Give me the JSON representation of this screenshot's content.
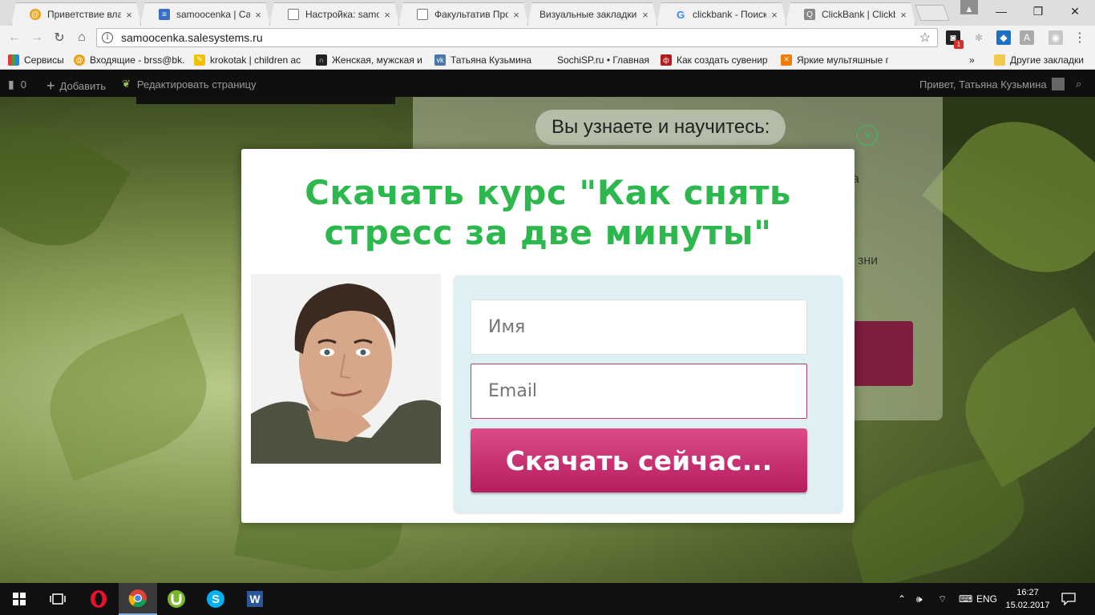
{
  "browser": {
    "tabs": [
      {
        "title": "Приветствие влад",
        "icon": "at-icon",
        "active": false
      },
      {
        "title": "samoocenka | Сайт",
        "icon": "page-blue-icon",
        "active": true
      },
      {
        "title": "Настройка: samoo",
        "icon": "doc-icon",
        "active": false
      },
      {
        "title": "Факультатив Прод",
        "icon": "doc-icon",
        "active": false
      },
      {
        "title": "Визуальные закладки",
        "icon": "bookmarks-icon",
        "active": false
      },
      {
        "title": "clickbank - Поиск",
        "icon": "google-icon",
        "active": false
      },
      {
        "title": "ClickBank | Clickba",
        "icon": "search-page-icon",
        "active": false
      }
    ],
    "url": "samoocenka.salesystems.ru",
    "extension_badge": "1",
    "bookmarks": [
      {
        "label": "Сервисы",
        "icon": "apps-icon"
      },
      {
        "label": "Входящие - brss@bk.",
        "icon": "mail-icon"
      },
      {
        "label": "krokotak | children ac",
        "icon": "crayon-icon"
      },
      {
        "label": "Женская, мужская и",
        "icon": "doorway-icon"
      },
      {
        "label": "Татьяна Кузьмина",
        "icon": "vk-icon"
      },
      {
        "label": "SochiSP.ru • Главная",
        "icon": "blank-icon"
      },
      {
        "label": "Как создать сувенир",
        "icon": "cf-icon"
      },
      {
        "label": "Яркие мультяшные п",
        "icon": "x-icon"
      }
    ],
    "bookmarks_overflow": "»",
    "other_bookmarks": "Другие закладки"
  },
  "adminbar": {
    "comments_count": "0",
    "add_label": "Добавить",
    "edit_label": "Редактировать страницу",
    "greeting": "Привет, Татьяна Кузьмина"
  },
  "background_page": {
    "heading": "Вы узнаете и научитесь:",
    "fragment_1": "а",
    "fragment_2": "зни"
  },
  "popup": {
    "close_label": "X",
    "title": "Скачать курс \"Как снять стресс за две минуты\"",
    "name_placeholder": "Имя",
    "email_placeholder": "Email",
    "submit_label": "Скачать сейчас..."
  },
  "taskbar": {
    "apps": [
      {
        "name": "opera-icon",
        "active": false
      },
      {
        "name": "chrome-icon",
        "active": true
      },
      {
        "name": "utorrent-icon",
        "active": false
      },
      {
        "name": "skype-icon",
        "active": false
      },
      {
        "name": "word-icon",
        "active": false
      }
    ],
    "language": "ENG",
    "time": "16:27",
    "date": "15.02.2017"
  },
  "colors": {
    "popup_title": "#2db84d",
    "submit_button": "#c4286b",
    "form_box": "#dff0f5",
    "adminbar": "#0f0f0f"
  }
}
